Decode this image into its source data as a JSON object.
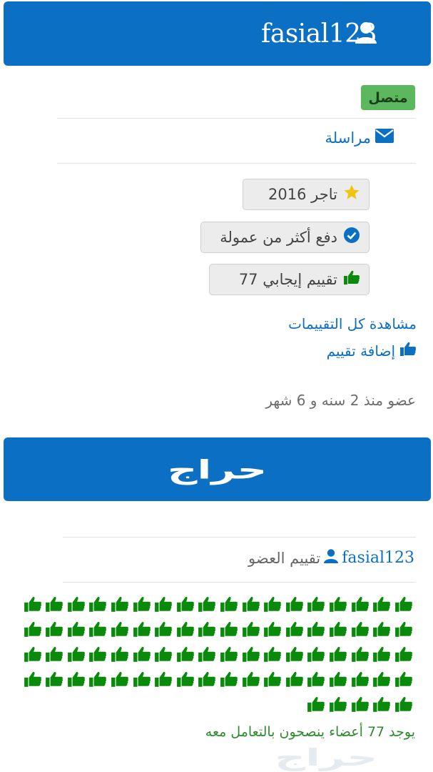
{
  "header": {
    "username": "fasial123",
    "icon": "user-icon"
  },
  "status": {
    "label": "متصل",
    "color": "#5cb85c"
  },
  "contact": {
    "message_label": "مراسلة",
    "icon": "envelope-icon"
  },
  "badges": [
    {
      "label": "تاجر 2016",
      "icon": "star-icon"
    },
    {
      "label": "دفع أكثر من عمولة",
      "icon": "check-circle-icon"
    },
    {
      "label": "77 تقييم إيجابي",
      "icon": "thumbs-up-icon"
    }
  ],
  "links": {
    "view_all_ratings": "مشاهدة كل التقييمات",
    "add_rating": "إضافة تقييم"
  },
  "member_since": "عضو منذ 2 سنه و 6 شهر",
  "banner": {
    "logo_text": "حراج"
  },
  "ratings": {
    "label": "تقييم العضو",
    "username": "fasial123",
    "positive_count": 77,
    "summary": "يوجد 77 أعضاء ينصحون بالتعامل معه"
  },
  "watermark_text": "حراج",
  "colors": {
    "brand_blue": "#0b6fc3",
    "thumb_green": "#0a8a0a",
    "status_green": "#5cb85c"
  }
}
